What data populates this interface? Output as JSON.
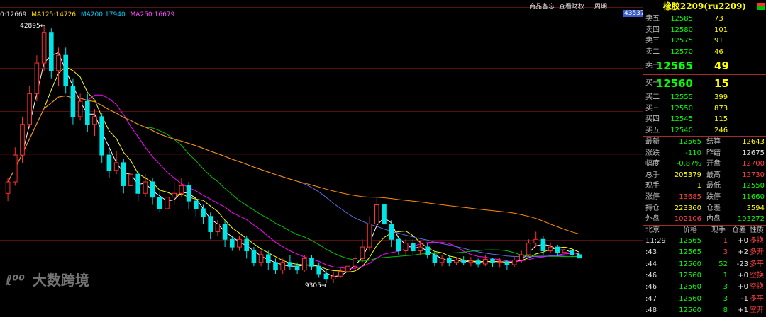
{
  "legend": {
    "ma1": "0:12669",
    "ma125": "MA125:14726",
    "ma200": "MA200:17940",
    "ma250": "MA250:16679"
  },
  "toolbar": {
    "link1": "商品备忘",
    "link2": "查看财权",
    "link3": "周期"
  },
  "price_marks": {
    "high": "42895",
    "low": "9305",
    "right_tag": "43537"
  },
  "watermark": "大数跨境",
  "panel": {
    "title": "橡胶2209(ru2209)",
    "asks": [
      {
        "label": "卖五",
        "price": "12585",
        "vol": "73"
      },
      {
        "label": "卖四",
        "price": "12580",
        "vol": "101"
      },
      {
        "label": "卖三",
        "price": "12575",
        "vol": "91"
      },
      {
        "label": "卖二",
        "price": "12570",
        "vol": "46"
      },
      {
        "label": "卖一",
        "price": "12565",
        "vol": "49"
      }
    ],
    "bids": [
      {
        "label": "买一",
        "price": "12560",
        "vol": "15"
      },
      {
        "label": "买二",
        "price": "12555",
        "vol": "399"
      },
      {
        "label": "买三",
        "price": "12550",
        "vol": "873"
      },
      {
        "label": "买四",
        "price": "12545",
        "vol": "115"
      },
      {
        "label": "买五",
        "price": "12540",
        "vol": "246"
      }
    ],
    "stats": [
      {
        "l1": "最新",
        "v1": "12565",
        "c1": "g",
        "l2": "结算",
        "v2": "12643",
        "c2": "y"
      },
      {
        "l1": "涨跌",
        "v1": "-110",
        "c1": "g",
        "l2": "昨结",
        "v2": "12675",
        "c2": "w"
      },
      {
        "l1": "幅度",
        "v1": "-0.87%",
        "c1": "g",
        "l2": "开盘",
        "v2": "12700",
        "c2": "r"
      },
      {
        "l1": "总手",
        "v1": "205379",
        "c1": "y",
        "l2": "最高",
        "v2": "12730",
        "c2": "r"
      },
      {
        "l1": "现手",
        "v1": "1",
        "c1": "y",
        "l2": "最低",
        "v2": "12550",
        "c2": "g"
      },
      {
        "l1": "涨停",
        "v1": "13685",
        "c1": "r",
        "l2": "跌停",
        "v2": "11660",
        "c2": "g"
      },
      {
        "l1": "持仓",
        "v1": "223360",
        "c1": "y",
        "l2": "仓差",
        "v2": "3594",
        "c2": "y"
      },
      {
        "l1": "外盘",
        "v1": "102106",
        "c1": "r",
        "l2": "内盘",
        "v2": "103272",
        "c2": "g"
      }
    ],
    "ticks_header": {
      "loc": "北京",
      "price": "价格",
      "qty": "现手",
      "oi": "仓差",
      "nature": "性质"
    },
    "ticks": [
      {
        "time": "11:29",
        "price": "12565",
        "qty": "1",
        "qc": "r",
        "oi": "+0",
        "nature": "多换"
      },
      {
        "time": ":43",
        "price": "12565",
        "qty": "3",
        "qc": "r",
        "oi": "+2",
        "nature": "多开"
      },
      {
        "time": ":44",
        "price": "12560",
        "qty": "52",
        "qc": "g",
        "oi": "-23",
        "nature": "多平"
      },
      {
        "time": ":46",
        "price": "12560",
        "qty": "1",
        "qc": "g",
        "oi": "+0",
        "nature": "空换"
      },
      {
        "time": ":46",
        "price": "12560",
        "qty": "3",
        "qc": "g",
        "oi": "+0",
        "nature": "空换"
      },
      {
        "time": ":47",
        "price": "12560",
        "qty": "3",
        "qc": "g",
        "oi": "-1",
        "nature": "多平"
      },
      {
        "time": ":48",
        "price": "12560",
        "qty": "8",
        "qc": "g",
        "oi": "+1",
        "nature": "空开"
      }
    ]
  },
  "colors": {
    "up": "#ff3030",
    "down": "#00e5e5",
    "ma_fast": "#ffffff",
    "ma_yellow": "#ffff00",
    "ma_magenta": "#ff00ff",
    "ma_green": "#00c000",
    "ma125": "#5b6ee6",
    "ma250": "#ff8c00"
  },
  "chart_data": {
    "type": "candlestick",
    "title": "",
    "ylim": [
      9305,
      42895
    ],
    "annotations": [
      {
        "text": "42895",
        "label": "high"
      },
      {
        "text": "9305",
        "label": "low"
      }
    ],
    "series": [
      {
        "name": "MA125",
        "value": 14726
      },
      {
        "name": "MA200",
        "value": 17940
      },
      {
        "name": "MA250",
        "value": 16679
      }
    ],
    "candles": [
      [
        21000,
        22500,
        20000,
        23000
      ],
      [
        22500,
        26000,
        22000,
        27000
      ],
      [
        26000,
        30000,
        25000,
        31000
      ],
      [
        30000,
        34000,
        29500,
        35000
      ],
      [
        34000,
        38000,
        33000,
        39000
      ],
      [
        38000,
        42000,
        37000,
        42895
      ],
      [
        42000,
        37000,
        36000,
        42500
      ],
      [
        37000,
        39000,
        35000,
        40000
      ],
      [
        39000,
        35000,
        34000,
        40000
      ],
      [
        35000,
        31000,
        30000,
        36000
      ],
      [
        31000,
        33000,
        30500,
        34000
      ],
      [
        33000,
        30000,
        29000,
        34000
      ],
      [
        30000,
        31000,
        28500,
        32000
      ],
      [
        31000,
        26000,
        25000,
        31500
      ],
      [
        26000,
        24000,
        23000,
        27000
      ],
      [
        24000,
        25000,
        23500,
        26500
      ],
      [
        25000,
        22000,
        21000,
        25500
      ],
      [
        22000,
        23500,
        21500,
        24500
      ],
      [
        23500,
        21000,
        20000,
        24000
      ],
      [
        21000,
        22500,
        20500,
        23500
      ],
      [
        22500,
        20500,
        19500,
        23000
      ],
      [
        20500,
        19000,
        18500,
        21500
      ],
      [
        19000,
        20500,
        18500,
        21000
      ],
      [
        20500,
        21000,
        19500,
        22500
      ],
      [
        21000,
        22000,
        20500,
        23000
      ],
      [
        22000,
        20000,
        19000,
        22500
      ],
      [
        20000,
        19000,
        18000,
        20500
      ],
      [
        19000,
        18000,
        17000,
        19500
      ],
      [
        18000,
        16000,
        15000,
        18500
      ],
      [
        16000,
        17000,
        15500,
        17500
      ],
      [
        17000,
        15000,
        14000,
        17500
      ],
      [
        15000,
        14000,
        13500,
        15500
      ],
      [
        14000,
        15000,
        13500,
        15500
      ],
      [
        15000,
        13500,
        12500,
        15500
      ],
      [
        13500,
        12000,
        11500,
        14000
      ],
      [
        12000,
        13000,
        11500,
        13500
      ],
      [
        13000,
        12000,
        11000,
        13500
      ],
      [
        12000,
        11000,
        10500,
        12500
      ],
      [
        11000,
        12000,
        10500,
        12500
      ],
      [
        12000,
        11500,
        11000,
        13000
      ],
      [
        11500,
        11000,
        10500,
        12000
      ],
      [
        11000,
        12500,
        10800,
        13000
      ],
      [
        12500,
        11500,
        11000,
        13000
      ],
      [
        11500,
        10500,
        10000,
        12000
      ],
      [
        10500,
        9800,
        9305,
        11000
      ],
      [
        9800,
        10200,
        9305,
        10800
      ],
      [
        10200,
        10800,
        10000,
        11200
      ],
      [
        10800,
        11500,
        10500,
        12000
      ],
      [
        11500,
        12500,
        11000,
        13000
      ],
      [
        12500,
        14000,
        12000,
        15000
      ],
      [
        14000,
        17000,
        13500,
        18000
      ],
      [
        17000,
        19500,
        16500,
        20500
      ],
      [
        19500,
        17000,
        16000,
        20000
      ],
      [
        17000,
        15000,
        14000,
        17500
      ],
      [
        15000,
        13500,
        13000,
        15500
      ],
      [
        13500,
        14500,
        13000,
        15000
      ],
      [
        14500,
        13500,
        13000,
        15000
      ],
      [
        13500,
        14000,
        13000,
        14800
      ],
      [
        14000,
        13000,
        12500,
        14500
      ],
      [
        13000,
        12000,
        11500,
        13500
      ],
      [
        12000,
        12500,
        11500,
        13000
      ],
      [
        12500,
        12000,
        11500,
        13000
      ],
      [
        12000,
        12300,
        11600,
        12700
      ],
      [
        12300,
        12000,
        11600,
        12800
      ],
      [
        12000,
        12200,
        11500,
        12700
      ],
      [
        12200,
        11800,
        11300,
        12500
      ],
      [
        11800,
        12400,
        11500,
        12900
      ],
      [
        12400,
        12000,
        11400,
        12600
      ],
      [
        12000,
        12100,
        11300,
        12600
      ],
      [
        12100,
        11700,
        11000,
        12300
      ],
      [
        11700,
        12300,
        11400,
        12800
      ],
      [
        12300,
        13000,
        12000,
        13500
      ],
      [
        13000,
        14500,
        12800,
        15000
      ],
      [
        14500,
        15000,
        14000,
        16000
      ],
      [
        15000,
        13500,
        13000,
        15500
      ],
      [
        13500,
        14000,
        13200,
        14600
      ],
      [
        14000,
        13300,
        12800,
        14300
      ],
      [
        13300,
        13600,
        13000,
        14000
      ],
      [
        13600,
        13000,
        12600,
        13800
      ],
      [
        13000,
        12565,
        12550,
        13300
      ]
    ]
  }
}
